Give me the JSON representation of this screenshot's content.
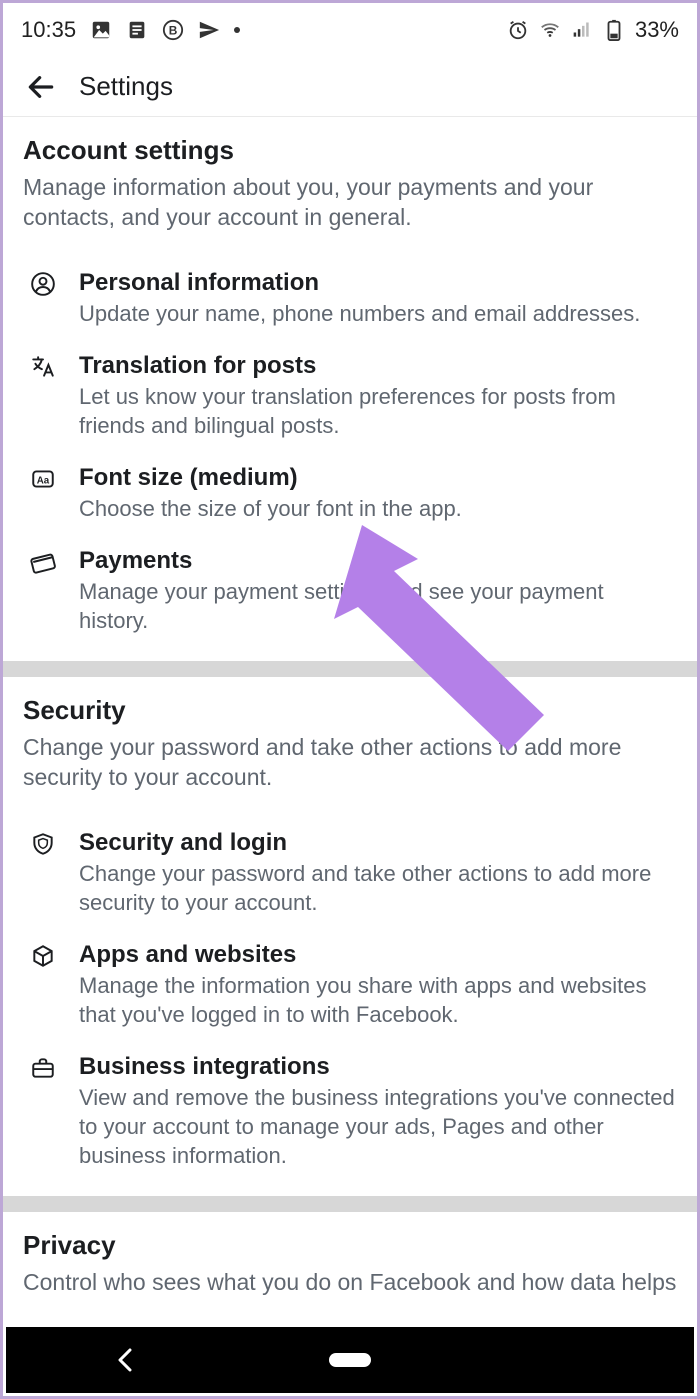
{
  "status": {
    "time": "10:35",
    "battery": "33%"
  },
  "header": {
    "title": "Settings"
  },
  "sections": [
    {
      "title": "Account settings",
      "desc": "Manage information about you, your payments and your contacts, and your account in general.",
      "items": [
        {
          "title": "Personal information",
          "sub": "Update your name, phone numbers and email addresses."
        },
        {
          "title": "Translation for posts",
          "sub": "Let us know your translation preferences for posts from friends and bilingual posts."
        },
        {
          "title": "Font size (medium)",
          "sub": "Choose the size of your font in the app."
        },
        {
          "title": "Payments",
          "sub": "Manage your payment settings and see your payment history."
        }
      ]
    },
    {
      "title": "Security",
      "desc": "Change your password and take other actions to add more security to your account.",
      "items": [
        {
          "title": "Security and login",
          "sub": "Change your password and take other actions to add more security to your account."
        },
        {
          "title": "Apps and websites",
          "sub": "Manage the information you share with apps and websites that you've logged in to with Facebook."
        },
        {
          "title": "Business integrations",
          "sub": "View and remove the business integrations you've connected to your account to manage your ads, Pages and other business information."
        }
      ]
    },
    {
      "title": "Privacy",
      "desc": "Control who sees what you do on Facebook and how data helps",
      "items": []
    }
  ],
  "annotation": {
    "color": "#b480e8",
    "target": "item-font-size"
  }
}
